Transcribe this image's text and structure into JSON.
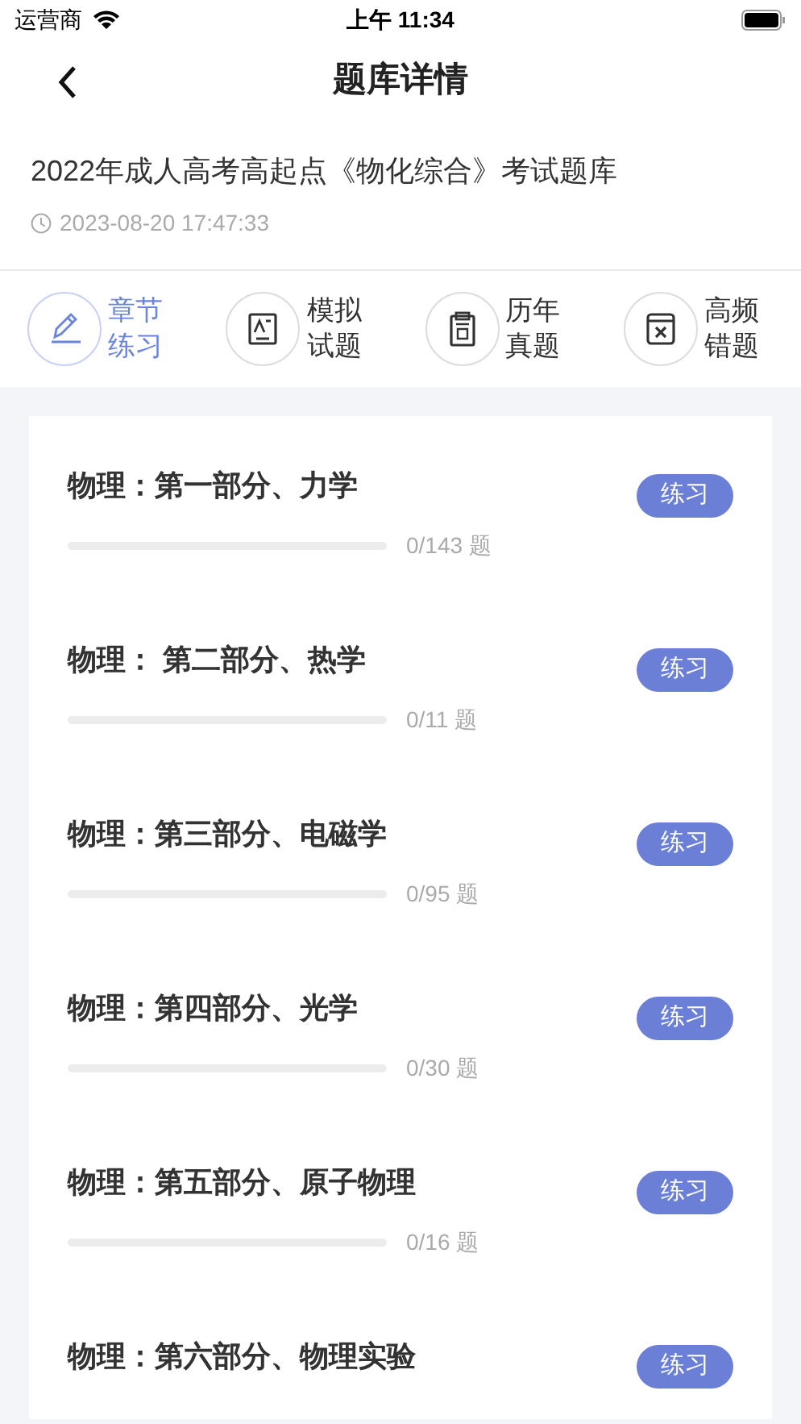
{
  "status_bar": {
    "carrier": "运营商",
    "time": "上午 11:34"
  },
  "nav": {
    "title": "题库详情"
  },
  "bank": {
    "title": "2022年成人高考高起点《物化综合》考试题库",
    "date": "2023-08-20 17:47:33"
  },
  "tabs": [
    {
      "kind": "pencil",
      "label": "章节练习",
      "selected": true
    },
    {
      "kind": "paper",
      "label": "模拟试题",
      "selected": false
    },
    {
      "kind": "clipboard",
      "label": "历年真题",
      "selected": false
    },
    {
      "kind": "cross",
      "label": "高频错题",
      "selected": false
    }
  ],
  "chapters": [
    {
      "title": "物理：第一部分、力学",
      "count": "0/143 题",
      "button": "练习"
    },
    {
      "title": "物理： 第二部分、热学",
      "count": "0/11 题",
      "button": "练习"
    },
    {
      "title": "物理：第三部分、电磁学",
      "count": "0/95 题",
      "button": "练习"
    },
    {
      "title": "物理：第四部分、光学",
      "count": "0/30 题",
      "button": "练习"
    },
    {
      "title": "物理：第五部分、原子物理",
      "count": "0/16 题",
      "button": "练习"
    },
    {
      "title": "物理：第六部分、物理实验",
      "button": "练习"
    }
  ]
}
